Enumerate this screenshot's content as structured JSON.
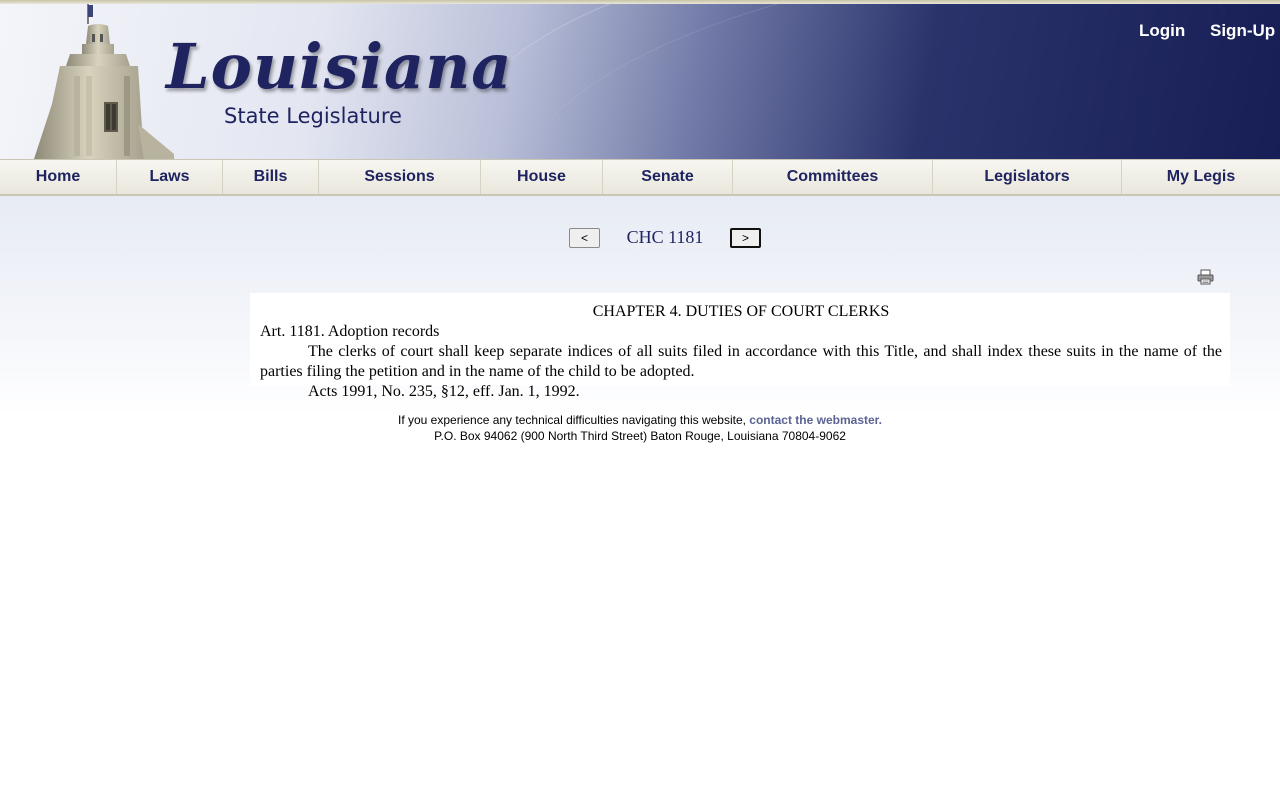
{
  "header": {
    "logo_title": "Louisiana",
    "logo_subtitle": "State Legislature",
    "login": "Login",
    "signup": "Sign-Up"
  },
  "nav": {
    "items": [
      {
        "label": "Home"
      },
      {
        "label": "Laws"
      },
      {
        "label": "Bills"
      },
      {
        "label": "Sessions"
      },
      {
        "label": "House"
      },
      {
        "label": "Senate"
      },
      {
        "label": "Committees"
      },
      {
        "label": "Legislators"
      },
      {
        "label": "My Legis"
      }
    ]
  },
  "pager": {
    "prev_label": "<",
    "next_label": ">",
    "doc_id": "CHC 1181"
  },
  "document": {
    "chapter": "CHAPTER 4.  DUTIES OF COURT CLERKS",
    "article": "Art. 1181.  Adoption records",
    "body": "The clerks of court shall keep separate indices of all suits filed in accordance with this Title, and shall index these suits in the name of the parties filing the petition and in the name of the child to be adopted.",
    "history": "Acts 1991, No. 235, §12, eff. Jan. 1, 1992."
  },
  "footer": {
    "notice": "If you experience any technical difficulties navigating this website, ",
    "contact_link": "contact the webmaster.",
    "address": "P.O. Box 94062 (900 North Third Street) Baton Rouge, Louisiana 70804-9062"
  },
  "colors": {
    "brand_navy": "#1f2460",
    "link": "#5a6392"
  },
  "icons": [
    "print-icon"
  ]
}
